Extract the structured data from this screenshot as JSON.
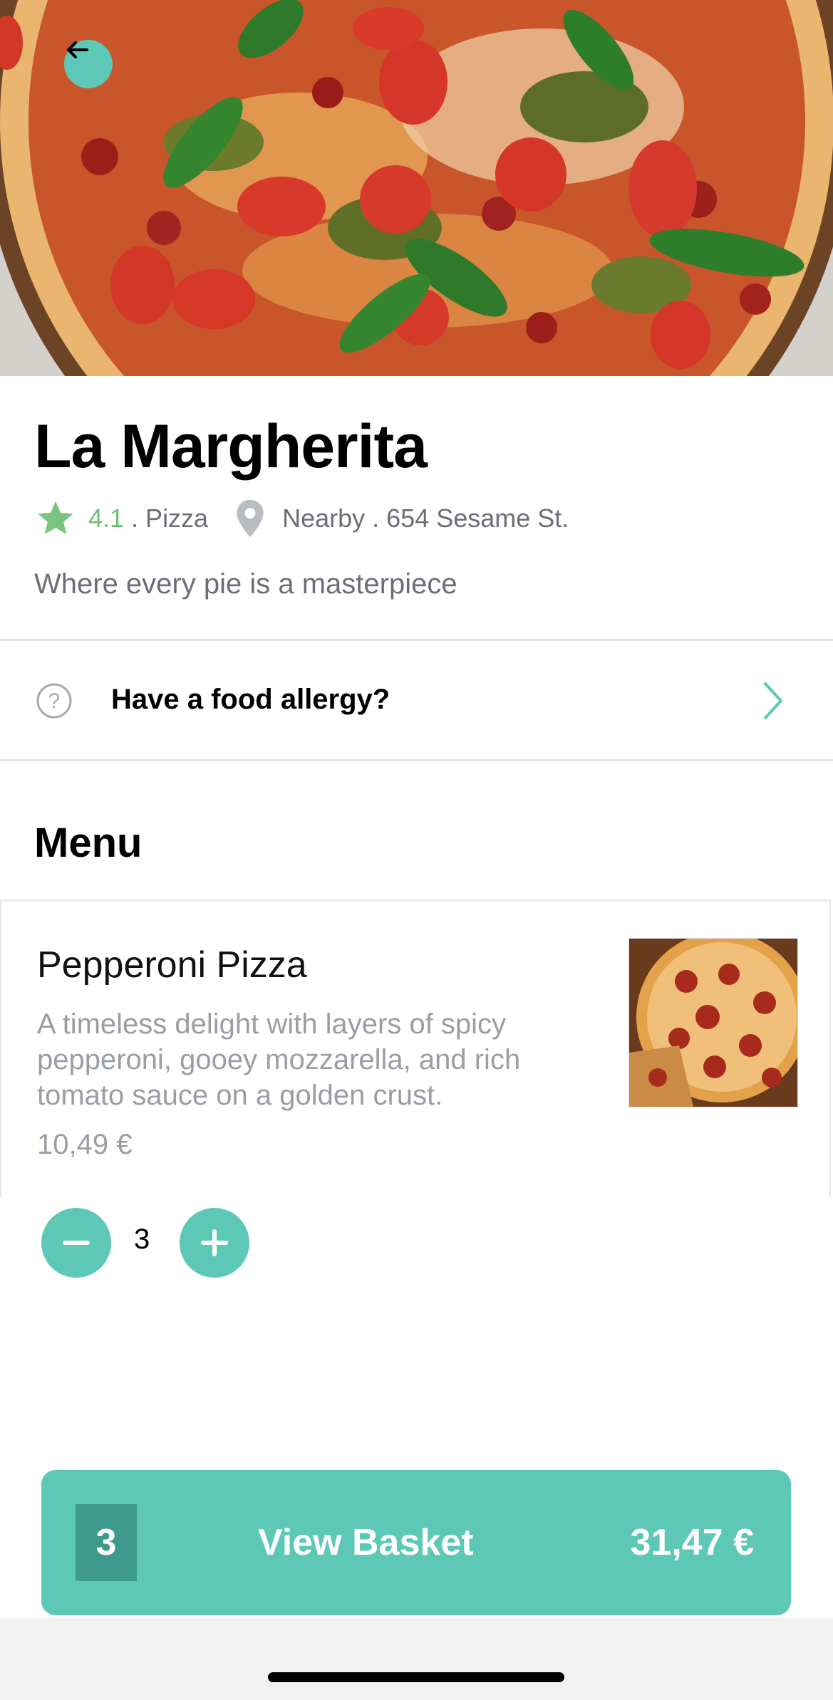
{
  "restaurant": {
    "name": "La Margherita",
    "rating": "4.1",
    "category": ". Pizza",
    "location": "Nearby . 654 Sesame St.",
    "tagline": "Where every pie is a masterpiece"
  },
  "allergy": {
    "label": "Have a food allergy?"
  },
  "menu": {
    "heading": "Menu",
    "items": [
      {
        "name": "Pepperoni Pizza",
        "description": "A timeless delight with layers of spicy pepperoni, gooey mozzarella, and rich tomato sauce on a golden crust.",
        "price": "10,49 €",
        "quantity": "3"
      }
    ]
  },
  "basket": {
    "count": "3",
    "label": "View Basket",
    "total": "31,47 €"
  },
  "colors": {
    "accent": "#5ec8b6",
    "accent_dark": "#3d9a8d",
    "rating_green": "#6fbf73"
  },
  "icons": [
    "back-arrow-icon",
    "star-icon",
    "location-pin-icon",
    "question-circle-icon",
    "chevron-right-icon",
    "minus-icon",
    "plus-icon"
  ]
}
